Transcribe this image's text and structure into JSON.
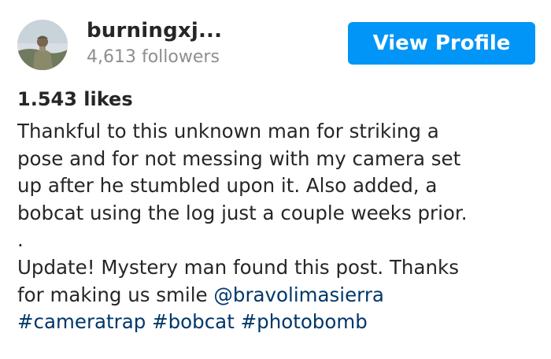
{
  "post": {
    "username": "burningxj...",
    "followers": "4,613 followers",
    "view_profile_label": "View Profile",
    "likes": "1.543 likes"
  },
  "caption": {
    "line1": "Thankful to this unknown man for striking a",
    "line2": "pose and for not messing with my camera set",
    "line3": "up after he stumbled upon it. Also added, a",
    "line4": "bobcat using the log just a couple weeks prior.",
    "line5": ".",
    "line6": "Update! Mystery man found this post. Thanks",
    "line7_prefix": "for making us smile ",
    "mention": "@bravolimasierra",
    "hashtags": [
      "#cameratrap",
      "#bobcat",
      "#photobomb"
    ]
  },
  "colors": {
    "button": "#0095f6",
    "link": "#00376b",
    "text": "#262626",
    "muted": "#8e8e8e"
  },
  "icons": {
    "avatar": "profile-photo"
  }
}
